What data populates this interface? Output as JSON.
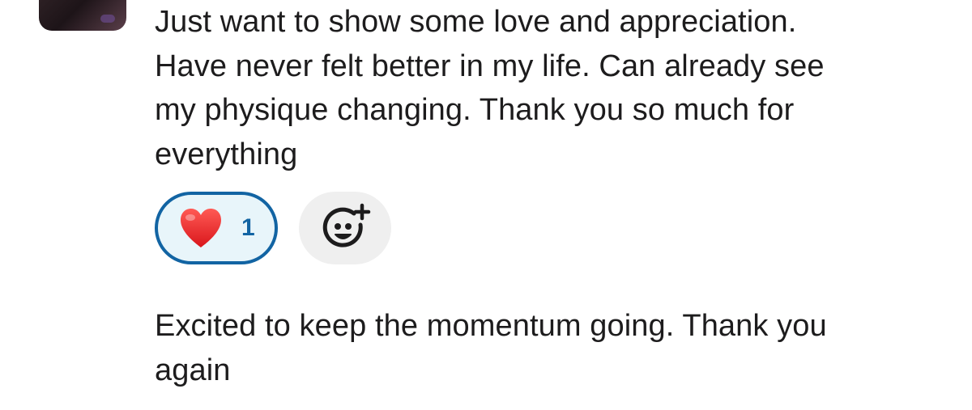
{
  "messages": [
    {
      "text": "Just want to show some love and appreciation.\nHave never felt better in my life. Can already see\nmy physique changing. Thank you so much for\neverything"
    },
    {
      "text": "Excited to keep the momentum going. Thank you\nagain"
    }
  ],
  "reactions": [
    {
      "emoji": "heart-icon",
      "count": "1",
      "selected": true
    }
  ],
  "colors": {
    "accent": "#1264a3",
    "reaction_bg": "#e8f5fa",
    "add_reaction_bg": "#efefef",
    "text": "#1d1c1d"
  }
}
